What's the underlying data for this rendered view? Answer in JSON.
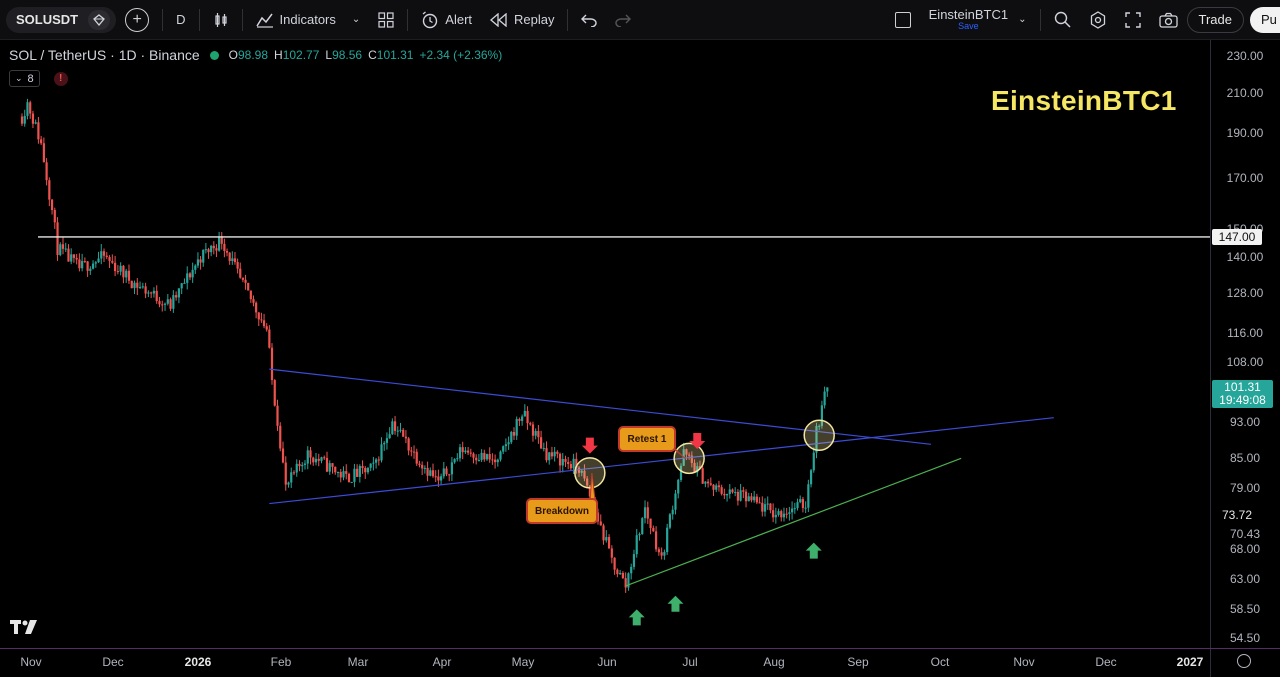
{
  "toolbar": {
    "symbol": "SOLUSDT",
    "interval": "D",
    "indicators_label": "Indicators",
    "alert_label": "Alert",
    "replay_label": "Replay",
    "layout_name": "EinsteinBTC1",
    "layout_save": "Save",
    "trade_label": "Trade",
    "publish_label": "Pu"
  },
  "legend": {
    "title": "SOL / TetherUS · 1D · Binance",
    "open_key": "O",
    "open": "98.98",
    "high_key": "H",
    "high": "102.77",
    "low_key": "L",
    "low": "98.56",
    "close_key": "C",
    "close": "101.31",
    "change": "+2.34 (+2.36%)",
    "indicator_count": "8",
    "error_badge": "!"
  },
  "watermark": "EinsteinBTC1",
  "annotations": {
    "breakdown": "Breakdown",
    "retest": "Retest 1"
  },
  "price_axis": {
    "ticks": [
      "230.00",
      "210.00",
      "190.00",
      "170.00",
      "150.00",
      "140.00",
      "128.00",
      "116.00",
      "108.00",
      "93.00",
      "85.00",
      "79.00",
      "70.43",
      "68.00",
      "63.00",
      "58.50",
      "54.50"
    ],
    "level_tag": "147.00",
    "current_price": "101.31",
    "countdown": "19:49:08",
    "marker_low": "73.72"
  },
  "time_axis": {
    "labels": [
      "Nov",
      "Dec",
      "2026",
      "Feb",
      "Mar",
      "Apr",
      "May",
      "Jun",
      "Jul",
      "Aug",
      "Sep",
      "Oct",
      "Nov",
      "Dec",
      "2027"
    ]
  },
  "colors": {
    "up": "#26a69a",
    "down": "#ef5350",
    "trendline": "#3d4bd6",
    "support": "#4caf50",
    "watermark": "#f5e663",
    "callout": "#e89a1a"
  },
  "chart_data": {
    "type": "candlestick",
    "symbol": "SOL / TetherUS",
    "interval": "1D",
    "exchange": "Binance",
    "ylim": [
      54.5,
      230
    ],
    "horizontal_level": 147.0,
    "anchors": [
      {
        "date": "2025-11-01",
        "price": 198
      },
      {
        "date": "2025-11-03",
        "price": 205
      },
      {
        "date": "2025-11-08",
        "price": 185
      },
      {
        "date": "2025-11-14",
        "price": 143
      },
      {
        "date": "2025-11-22",
        "price": 136
      },
      {
        "date": "2025-12-01",
        "price": 140
      },
      {
        "date": "2025-12-12",
        "price": 131
      },
      {
        "date": "2025-12-25",
        "price": 124
      },
      {
        "date": "2026-01-05",
        "price": 140
      },
      {
        "date": "2026-01-13",
        "price": 146
      },
      {
        "date": "2026-01-20",
        "price": 132
      },
      {
        "date": "2026-01-30",
        "price": 117
      },
      {
        "date": "2026-02-01",
        "price": 103
      },
      {
        "date": "2026-02-06",
        "price": 79
      },
      {
        "date": "2026-02-14",
        "price": 86
      },
      {
        "date": "2026-02-28",
        "price": 81
      },
      {
        "date": "2026-03-10",
        "price": 83
      },
      {
        "date": "2026-03-17",
        "price": 93
      },
      {
        "date": "2026-03-25",
        "price": 86
      },
      {
        "date": "2026-04-03",
        "price": 80
      },
      {
        "date": "2026-04-12",
        "price": 87
      },
      {
        "date": "2026-04-25",
        "price": 84
      },
      {
        "date": "2026-05-04",
        "price": 95
      },
      {
        "date": "2026-05-13",
        "price": 86
      },
      {
        "date": "2026-05-25",
        "price": 83
      },
      {
        "date": "2026-06-06",
        "price": 66
      },
      {
        "date": "2026-06-11",
        "price": 62
      },
      {
        "date": "2026-06-18",
        "price": 75
      },
      {
        "date": "2026-06-24",
        "price": 66
      },
      {
        "date": "2026-07-02",
        "price": 86
      },
      {
        "date": "2026-07-12",
        "price": 79
      },
      {
        "date": "2026-07-25",
        "price": 77
      },
      {
        "date": "2026-08-05",
        "price": 74
      },
      {
        "date": "2026-08-16",
        "price": 76
      },
      {
        "date": "2026-08-20",
        "price": 91
      },
      {
        "date": "2026-08-24",
        "price": 101.31
      }
    ],
    "trendlines": [
      {
        "role": "upper",
        "from": {
          "date": "2026-01-31",
          "price": 106
        },
        "to": {
          "date": "2026-10-01",
          "price": 88
        }
      },
      {
        "role": "lower",
        "from": {
          "date": "2026-01-31",
          "price": 76
        },
        "to": {
          "date": "2026-11-15",
          "price": 94
        }
      },
      {
        "role": "support",
        "from": {
          "date": "2026-06-11",
          "price": 62
        },
        "to": {
          "date": "2026-10-12",
          "price": 85
        }
      }
    ],
    "circles": [
      {
        "date": "2026-05-29",
        "price": 82
      },
      {
        "date": "2026-07-04",
        "price": 85
      },
      {
        "date": "2026-08-21",
        "price": 90
      }
    ],
    "arrows": [
      {
        "dir": "down",
        "color": "red",
        "date": "2026-05-29",
        "price": 86
      },
      {
        "dir": "down",
        "color": "red",
        "date": "2026-07-07",
        "price": 87
      },
      {
        "dir": "up",
        "color": "green",
        "date": "2026-06-15",
        "price": 58.5
      },
      {
        "dir": "up",
        "color": "green",
        "date": "2026-06-29",
        "price": 60.5
      },
      {
        "dir": "up",
        "color": "green",
        "date": "2026-08-19",
        "price": 69
      }
    ]
  }
}
